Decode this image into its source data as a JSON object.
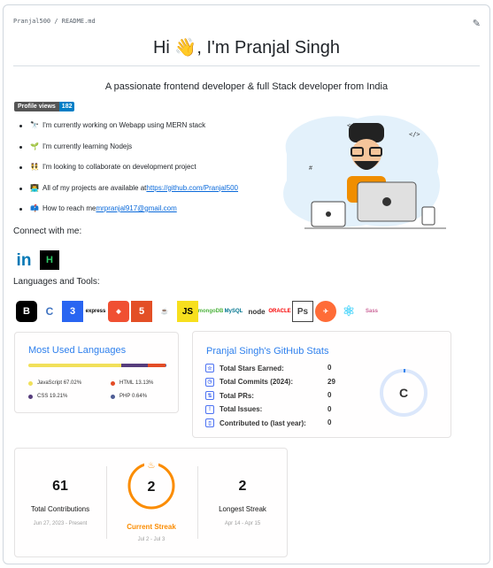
{
  "header": {
    "path": "Pranjal500 / README.md"
  },
  "title": "Hi 👋, I'm Pranjal Singh",
  "subtitle": "A passionate frontend developer & full Stack developer from India",
  "views_badge": {
    "label": "Profile views",
    "count": "182"
  },
  "bullets": [
    {
      "emoji": "🔭",
      "text": "I'm currently working on Webapp using MERN stack"
    },
    {
      "emoji": "🌱",
      "text": "I'm currently learning Nodejs"
    },
    {
      "emoji": "👯",
      "text": "I'm looking to collaborate on development project"
    },
    {
      "emoji": "👨‍💻",
      "text": "All of my projects are available at ",
      "link": "https://github.com/Pranjal500"
    },
    {
      "emoji": "📫",
      "text": "How to reach me ",
      "link": "mrpranjal917@gmail.com"
    }
  ],
  "connect_heading": "Connect with me:",
  "social": [
    {
      "icon": "linkedin-icon",
      "label": "in"
    },
    {
      "icon": "hackerrank-icon",
      "label": "H"
    }
  ],
  "tools_heading": "Languages and Tools:",
  "tools": [
    {
      "name": "bootstrap",
      "label": "B",
      "sub": "Bootstrap",
      "color": "#000000"
    },
    {
      "name": "c",
      "label": "C",
      "color": "#3f73c1"
    },
    {
      "name": "css3",
      "label": "3",
      "color": "#2965f1"
    },
    {
      "name": "express",
      "label": "express",
      "color": "#000000"
    },
    {
      "name": "git",
      "label": "◆",
      "color": "#f05032"
    },
    {
      "name": "html5",
      "label": "5",
      "color": "#e34f26"
    },
    {
      "name": "java",
      "label": "☕",
      "color": "#0074bd"
    },
    {
      "name": "javascript",
      "label": "JS",
      "color": "#f7df1e"
    },
    {
      "name": "mongodb",
      "label": "mongoDB",
      "color": "#4db33d"
    },
    {
      "name": "mysql",
      "label": "MySQL",
      "color": "#00758f"
    },
    {
      "name": "nodejs",
      "label": "node",
      "color": "#333333"
    },
    {
      "name": "oracle",
      "label": "ORACLE",
      "color": "#f80000"
    },
    {
      "name": "photoshop",
      "label": "Ps",
      "color": "#444444"
    },
    {
      "name": "postman",
      "label": "✈",
      "color": "#ff6c37"
    },
    {
      "name": "react",
      "label": "⚛",
      "color": "#61dafb"
    },
    {
      "name": "sass",
      "label": "Sass",
      "color": "#cc6699"
    }
  ],
  "languages_card": {
    "title": "Most Used Languages",
    "langs": [
      {
        "name": "JavaScript",
        "pct": "67.02%",
        "value": 67.02,
        "color": "#f1e05a"
      },
      {
        "name": "HTML",
        "pct": "13.13%",
        "value": 13.13,
        "color": "#e34c26"
      },
      {
        "name": "CSS",
        "pct": "19.21%",
        "value": 19.21,
        "color": "#563d7c"
      },
      {
        "name": "PHP",
        "pct": "0.64%",
        "value": 0.64,
        "color": "#4f5d95"
      }
    ]
  },
  "stats_card": {
    "title": "Pranjal Singh's GitHub Stats",
    "rows": [
      {
        "icon": "star-icon",
        "glyph": "☆",
        "label": "Total Stars Earned:",
        "value": "0"
      },
      {
        "icon": "clock-icon",
        "glyph": "◷",
        "label": "Total Commits (2024):",
        "value": "29"
      },
      {
        "icon": "pr-icon",
        "glyph": "⇅",
        "label": "Total PRs:",
        "value": "0"
      },
      {
        "icon": "issue-icon",
        "glyph": "!",
        "label": "Total Issues:",
        "value": "0"
      },
      {
        "icon": "repo-icon",
        "glyph": "▯",
        "label": "Contributed to (last year):",
        "value": "0"
      }
    ],
    "rank": "C"
  },
  "streak_card": {
    "total": {
      "value": "61",
      "label": "Total Contributions",
      "range": "Jun 27, 2023 - Present"
    },
    "current": {
      "value": "2",
      "label": "Current Streak",
      "range": "Jul 2 - Jul 3"
    },
    "longest": {
      "value": "2",
      "label": "Longest Streak",
      "range": "Apr 14 - Apr 15"
    }
  },
  "colors": {
    "accent": "#2f80ed",
    "streak": "#fb8c00"
  }
}
